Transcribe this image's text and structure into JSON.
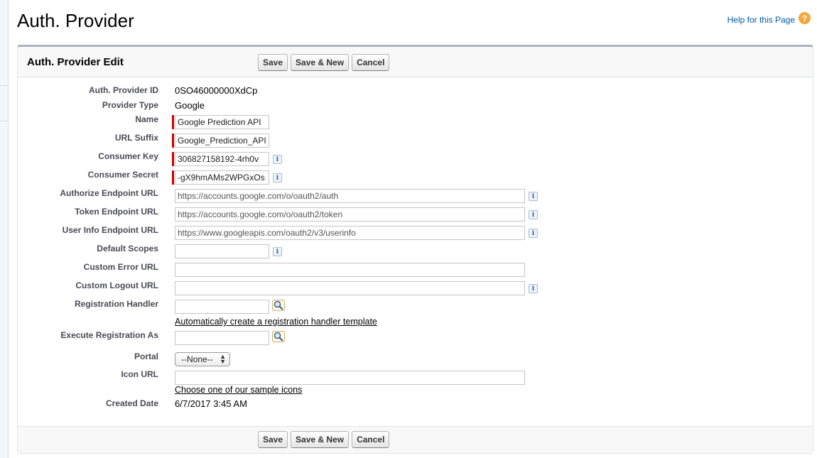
{
  "page": {
    "title": "Auth. Provider",
    "help_link": "Help for this Page",
    "help_icon": "?"
  },
  "panel": {
    "title": "Auth. Provider Edit",
    "buttons": {
      "save": "Save",
      "save_new": "Save & New",
      "cancel": "Cancel"
    }
  },
  "fields": {
    "auth_provider_id": {
      "label": "Auth. Provider ID",
      "value": "0SO46000000XdCp"
    },
    "provider_type": {
      "label": "Provider Type",
      "value": "Google"
    },
    "name": {
      "label": "Name",
      "value": "Google Prediction API"
    },
    "url_suffix": {
      "label": "URL Suffix",
      "value": "Google_Prediction_API"
    },
    "consumer_key": {
      "label": "Consumer Key",
      "value": "306827158192-4rh0v"
    },
    "consumer_secret": {
      "label": "Consumer Secret",
      "value": "-gX9hmAMs2WPGxOs"
    },
    "authorize_endpoint_url": {
      "label": "Authorize Endpoint URL",
      "value": "https://accounts.google.com/o/oauth2/auth"
    },
    "token_endpoint_url": {
      "label": "Token Endpoint URL",
      "value": "https://accounts.google.com/o/oauth2/token"
    },
    "user_info_endpoint_url": {
      "label": "User Info Endpoint URL",
      "value": "https://www.googleapis.com/oauth2/v3/userinfo"
    },
    "default_scopes": {
      "label": "Default Scopes",
      "value": ""
    },
    "custom_error_url": {
      "label": "Custom Error URL",
      "value": ""
    },
    "custom_logout_url": {
      "label": "Custom Logout URL",
      "value": ""
    },
    "registration_handler": {
      "label": "Registration Handler",
      "value": "",
      "link": "Automatically create a registration handler template"
    },
    "execute_registration_as": {
      "label": "Execute Registration As",
      "value": ""
    },
    "portal": {
      "label": "Portal",
      "selected": "--None--"
    },
    "icon_url": {
      "label": "Icon URL",
      "value": "",
      "link": "Choose one of our sample icons"
    },
    "created_date": {
      "label": "Created Date",
      "value": "6/7/2017 3:45 AM"
    }
  },
  "icons": {
    "info": "i",
    "info_name": "info-icon",
    "lookup_name": "lookup-magnifier-icon"
  },
  "colors": {
    "required": "#cc0000",
    "link": "#015ba7",
    "help": "#f2a93b",
    "panel_border": "#aab3c1"
  }
}
